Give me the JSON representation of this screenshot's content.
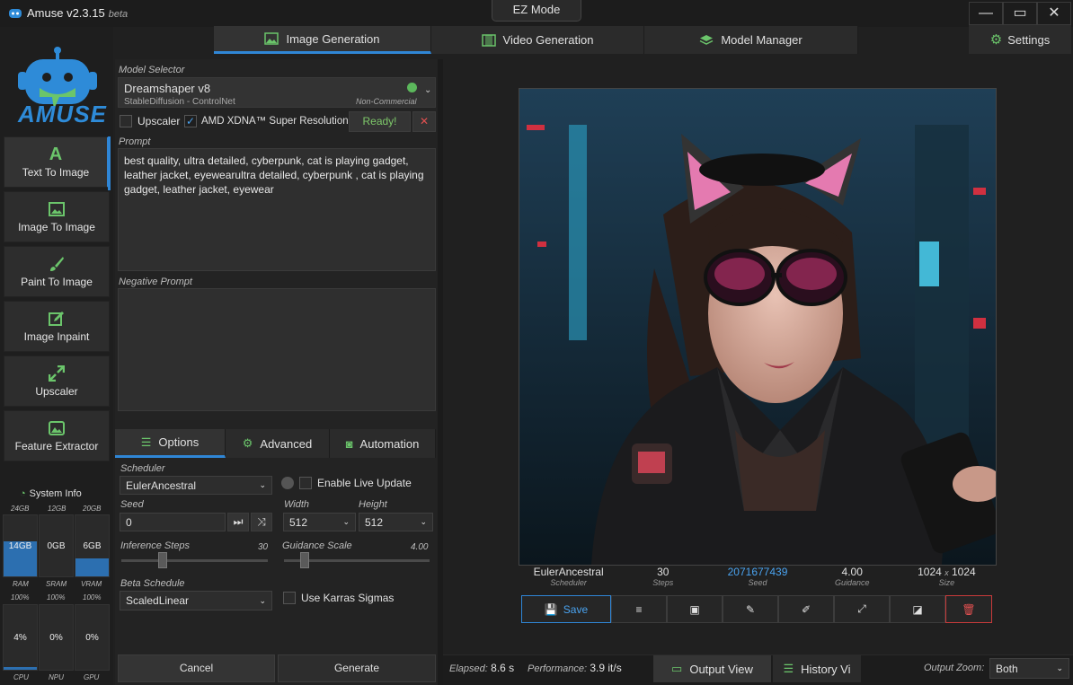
{
  "app": {
    "title": "Amuse v2.3.15",
    "badge": "beta",
    "ez_mode": "EZ Mode",
    "logo_text": "AMUSE"
  },
  "window": {
    "minimize": "—",
    "maximize": "▭",
    "close": "✕"
  },
  "tabs": [
    {
      "label": "Image Generation",
      "icon": "image-icon"
    },
    {
      "label": "Video Generation",
      "icon": "film-icon"
    },
    {
      "label": "Model Manager",
      "icon": "layers-icon"
    }
  ],
  "settings_tab": "Settings",
  "nav": [
    {
      "label": "Text To Image"
    },
    {
      "label": "Image To Image"
    },
    {
      "label": "Paint To Image"
    },
    {
      "label": "Image Inpaint"
    },
    {
      "label": "Upscaler"
    },
    {
      "label": "Feature Extractor"
    }
  ],
  "sysinfo": {
    "title": "System Info",
    "caps": [
      "24GB",
      "12GB",
      "20GB"
    ],
    "mem": [
      {
        "value": "14GB",
        "label": "RAM",
        "fill": 0.58
      },
      {
        "value": "0GB",
        "label": "SRAM",
        "fill": 0
      },
      {
        "value": "6GB",
        "label": "VRAM",
        "fill": 0.3
      }
    ],
    "pct_caps": [
      "100%",
      "100%",
      "100%"
    ],
    "usage": [
      {
        "value": "4%",
        "label": "CPU",
        "fill": 0.04
      },
      {
        "value": "0%",
        "label": "NPU",
        "fill": 0
      },
      {
        "value": "0%",
        "label": "GPU",
        "fill": 0
      }
    ]
  },
  "model": {
    "section_label": "Model Selector",
    "name": "Dreamshaper v8",
    "sub": "StableDiffusion - ControlNet",
    "license": "Non-Commercial",
    "status_color": "#5cb85c"
  },
  "upscaler": {
    "label": "Upscaler",
    "checked": false
  },
  "xdna": {
    "label": "AMD XDNA™ Super Resolution",
    "checked": true
  },
  "ready": {
    "label": "Ready!",
    "color": "#7ec96a"
  },
  "prompt": {
    "label": "Prompt",
    "value": "best quality, ultra detailed, cyberpunk, cat is playing gadget, leather jacket, eyewearultra detailed, cyberpunk , cat is playing gadget, leather jacket, eyewear"
  },
  "negative_prompt": {
    "label": "Negative Prompt",
    "value": ""
  },
  "subtabs": [
    {
      "label": "Options",
      "icon": "sliders-icon"
    },
    {
      "label": "Advanced",
      "icon": "gears-icon"
    },
    {
      "label": "Automation",
      "icon": "robot-icon"
    }
  ],
  "options": {
    "scheduler_label": "Scheduler",
    "scheduler": "EulerAncestral",
    "live_update": "Enable Live Update",
    "seed_label": "Seed",
    "seed": "0",
    "width_label": "Width",
    "width": "512",
    "height_label": "Height",
    "height": "512",
    "steps_label": "Inference Steps",
    "steps": "30",
    "guidance_label": "Guidance Scale",
    "guidance": "4.00",
    "beta_label": "Beta Schedule",
    "beta": "ScaledLinear",
    "karras": "Use Karras Sigmas"
  },
  "actions": {
    "cancel": "Cancel",
    "generate": "Generate"
  },
  "result": {
    "scheduler": "EulerAncestral",
    "scheduler_cap": "Scheduler",
    "steps": "30",
    "steps_cap": "Steps",
    "seed": "2071677439",
    "seed_cap": "Seed",
    "guidance": "4.00",
    "guidance_cap": "Guidance",
    "width": "1024",
    "x": "x",
    "height": "1024",
    "size_cap": "Size"
  },
  "toolbar": {
    "save": "Save"
  },
  "status": {
    "elapsed_label": "Elapsed:",
    "elapsed": "8.6 s",
    "perf_label": "Performance:",
    "perf": "3.9 it/s",
    "output_view": "Output View",
    "history_view": "History Vi",
    "zoom_label": "Output Zoom:",
    "zoom": "Both"
  }
}
